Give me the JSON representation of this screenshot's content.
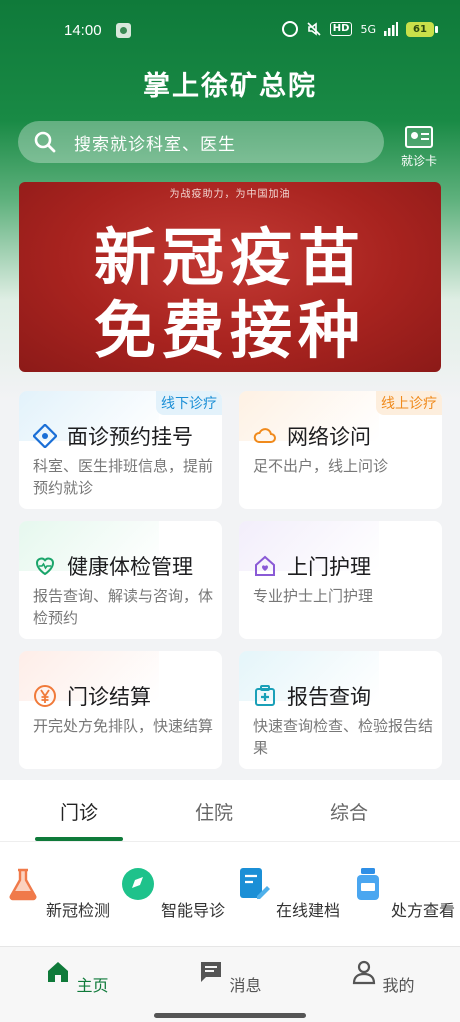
{
  "status_bar": {
    "time": "14:00",
    "network": "5G",
    "hd_label": "HD",
    "battery": "61"
  },
  "header": {
    "title": "掌上徐矿总院"
  },
  "search": {
    "placeholder": "搜索就诊科室、医生"
  },
  "visit_card": {
    "label": "就诊卡"
  },
  "banner": {
    "subtitle": "为战疫助力，为中国加油",
    "line1": "新冠疫苗",
    "line2": "免费接种"
  },
  "services": [
    {
      "title": "面诊预约挂号",
      "desc": "科室、医生排班信息，提前预约就诊",
      "tag": "线下诊疗",
      "icon": "diamond-icon"
    },
    {
      "title": "网络诊问",
      "desc": "足不出户，线上问诊",
      "tag": "线上诊疗",
      "icon": "cloud-icon"
    },
    {
      "title": "健康体检管理",
      "desc": "报告查询、解读与咨询，体检预约",
      "icon": "heart-icon"
    },
    {
      "title": "上门护理",
      "desc": "专业护士上门护理",
      "icon": "home-heart-icon"
    },
    {
      "title": "门诊结算",
      "desc": "开完处方免排队，快速结算",
      "icon": "yen-icon"
    },
    {
      "title": "报告查询",
      "desc": "快速查询检查、检验报告结果",
      "icon": "medkit-icon"
    }
  ],
  "tabs": [
    {
      "label": "门诊",
      "active": true
    },
    {
      "label": "住院",
      "active": false
    },
    {
      "label": "综合",
      "active": false
    }
  ],
  "quick_actions": [
    {
      "label": "新冠检测",
      "icon": "flask-icon"
    },
    {
      "label": "智能导诊",
      "icon": "compass-icon"
    },
    {
      "label": "在线建档",
      "icon": "document-edit-icon"
    },
    {
      "label": "处方查看",
      "icon": "medicine-bottle-icon"
    }
  ],
  "bottom_nav": [
    {
      "label": "主页",
      "icon": "home-icon",
      "active": true
    },
    {
      "label": "消息",
      "icon": "message-icon",
      "active": false
    },
    {
      "label": "我的",
      "icon": "user-icon",
      "active": false
    }
  ],
  "colors": {
    "brand": "#0f7a3a",
    "tag_offline": "#1b8fd6",
    "tag_online": "#f08a1c"
  }
}
